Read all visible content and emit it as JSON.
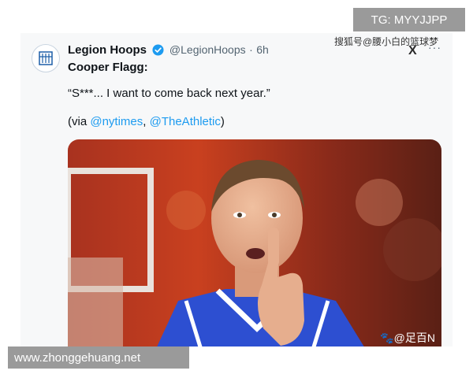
{
  "tweet": {
    "author_name": "Legion Hoops",
    "handle": "@LegionHoops",
    "separator": "·",
    "time": "6h",
    "more": "···",
    "line1": "Cooper Flagg:",
    "line2": "“S***... I want to come back next year.”",
    "via_open": "(via ",
    "via_link1": "@nytimes",
    "via_comma": ", ",
    "via_link2": "@TheAthletic",
    "via_close": ")"
  },
  "watermarks": {
    "tg": "TG: MYYJJPP",
    "site": "www.zhonggehuang.net",
    "sohu": "搜狐号@腰小白的篮球梦",
    "x_logo": "X",
    "zubai": "🐾@足百N"
  },
  "icons": {
    "verified": "verified-badge-icon",
    "avatar": "legion-hoops-logo"
  },
  "colors": {
    "link": "#1d9bf0",
    "verified": "#1d9bf0",
    "jersey": "#2d4fd1"
  }
}
